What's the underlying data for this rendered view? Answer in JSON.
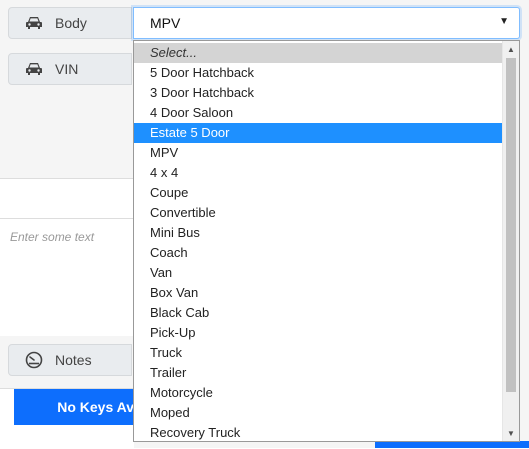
{
  "form": {
    "body_label": "Body",
    "vin_label": "VIN",
    "notes_label": "Notes",
    "textarea_placeholder": "Enter some text",
    "keys_button_label": "No Keys Av"
  },
  "select": {
    "current_value": "MPV",
    "options": [
      "Select...",
      "5 Door Hatchback",
      "3 Door Hatchback",
      "4 Door Saloon",
      "Estate 5 Door",
      "MPV",
      "4 x 4",
      "Coupe",
      "Convertible",
      "Mini Bus",
      "Coach",
      "Van",
      "Box Van",
      "Black Cab",
      "Pick-Up",
      "Truck",
      "Trailer",
      "Motorcycle",
      "Moped",
      "Recovery Truck"
    ],
    "highlighted_index": 4
  },
  "icons": {
    "body": "car-icon",
    "vin": "car-icon",
    "notes": "gauge-icon"
  },
  "colors": {
    "highlight": "#1e90ff",
    "primary": "#0d6efd"
  }
}
